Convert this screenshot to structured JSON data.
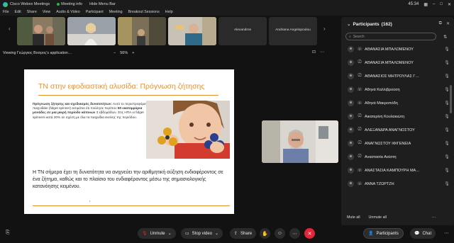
{
  "titlebar": {
    "app_name": "Cisco Webex Meetings",
    "meeting_info": "Meeting info",
    "hide_menu": "Hide Menu Bar",
    "time": "45:34"
  },
  "menu": [
    "File",
    "Edit",
    "Share",
    "View",
    "Audio & Video",
    "Participant",
    "Meeting",
    "Breakout Sessions",
    "Help"
  ],
  "thumbnails": {
    "name_4": "Alexandros",
    "name_5": "Andriana Angelopoulou"
  },
  "share": {
    "viewing": "Viewing Γεώργιος Βοσρος's application…",
    "zoom": "56%"
  },
  "slide": {
    "title": "ΤΝ στην εφοδιαστική αλυσίδα: Πρόγνωση ζήτησης",
    "bullet_heading": "Πρόγνωση ζήτησης και σχεδιασμός δυνατοτήτων:",
    "bullet_body_1": " Αυτό το περιστρεφόμενο παιχνιδάκι (fidget spinner) εκτιμάται ότι πούλησε περίπου ",
    "bullet_bold": "50 εκατομμύρια μονάδες σε μια μικρή περίοδο κάποιων",
    "bullet_body_2": " 3 εβδομάδων. Στις ΗΠΑ οι fidget spinners κατά 20% σε σχέση με όλα τα παιχνίδια εκείνης της περιόδου.",
    "main_text": "Η ΤΝ σήμερα έχει τη δυνατότητα να ανιχνεύει την αριθμητική αύξηση ενδιαφέροντος σε ένα ζήτημα, καθώς και το πλαίσιο του ενδιαφέροντος μέσω της σημασιολογικής κατανόησης κειμένου.",
    "footnote": "•"
  },
  "participants_panel": {
    "title": "Participants",
    "count": "(162)",
    "search_placeholder": "Search",
    "participants": [
      {
        "name": "ΑΘΑΝΑΣΙΑ ΜΠΑΛΟΜΕΝΟΥ",
        "device": "phone-icon"
      },
      {
        "name": "ΑΘΑΝΑΣΙΑ ΜΠΑΛΟΜΕΝΟΥ",
        "device": "video-icon"
      },
      {
        "name": "ΑΘΑΝΑΣΙΟΣ ΜΗΤΡΟΥΛΑΣ Γ…",
        "device": "video-icon"
      },
      {
        "name": "Αθηνά Καλλιβρούση",
        "device": "phone-icon"
      },
      {
        "name": "Αθηνά Μακροπόδη",
        "device": "phone-icon"
      },
      {
        "name": "Αικατερίνη Κουλακιώτη",
        "device": "video-icon"
      },
      {
        "name": "ΑΛΕΞΑΝΔΡΑ ΑΝΑΓΝΟΣΤΟΥ",
        "device": "video-icon"
      },
      {
        "name": "ΑΝΑΓΝΩΣΤΟΥ ΙΦΙΓΕΝΕΙΑ",
        "device": "video-icon"
      },
      {
        "name": "Αναστασία Ανέστη",
        "device": "video-icon"
      },
      {
        "name": "ΑΝΑΣΤΑΣΙΑ ΚΑΜΠΟΥΡΗ ΜΑ…",
        "device": "phone-icon"
      },
      {
        "name": "ΑΝΝΑ ΤΖΩΡΤΖΗ",
        "device": "phone-icon"
      }
    ],
    "mute_all": "Mute all",
    "unmute_all": "Unmute all"
  },
  "controls": {
    "unmute": "Unmute",
    "stop_video": "Stop video",
    "share": "Share",
    "participants": "Participants",
    "chat": "Chat"
  }
}
